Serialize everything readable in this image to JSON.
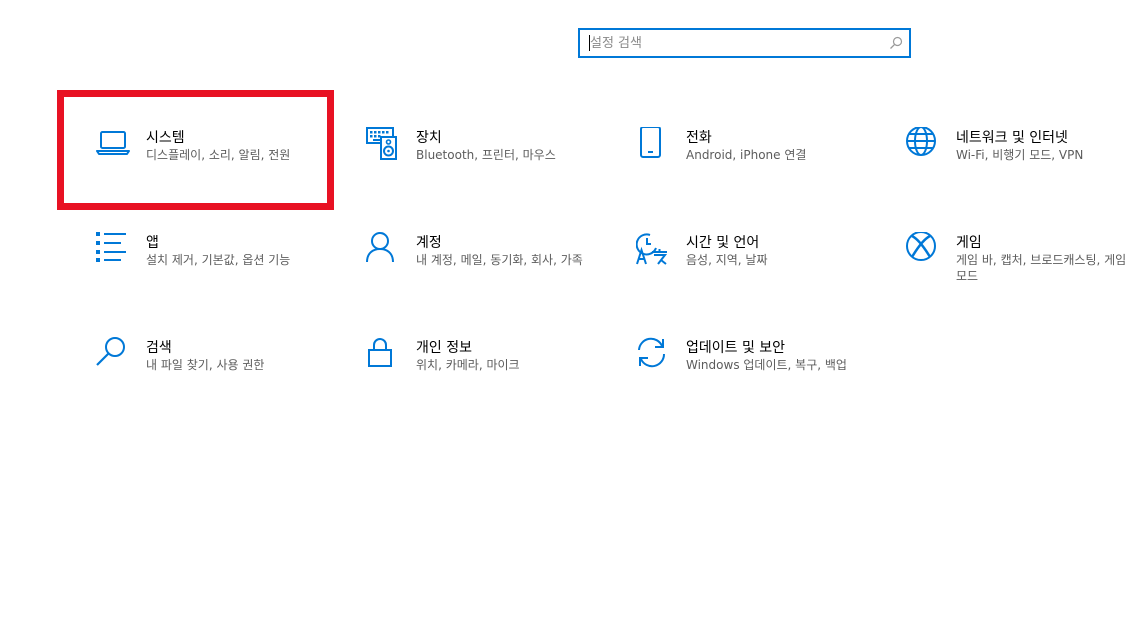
{
  "search": {
    "placeholder": "설정 검색"
  },
  "colors": {
    "accent": "#0078d7",
    "highlight": "#e81123"
  },
  "tiles": [
    {
      "title": "시스템",
      "desc": "디스플레이, 소리, 알림, 전원",
      "icon": "laptop-icon"
    },
    {
      "title": "장치",
      "desc": "Bluetooth, 프린터, 마우스",
      "icon": "keyboard-speaker-icon"
    },
    {
      "title": "전화",
      "desc": "Android, iPhone 연결",
      "icon": "phone-icon"
    },
    {
      "title": "네트워크 및 인터넷",
      "desc": "Wi-Fi, 비행기 모드, VPN",
      "icon": "globe-icon"
    },
    {
      "title": "앱",
      "desc": "설치 제거, 기본값, 옵션 기능",
      "icon": "apps-list-icon"
    },
    {
      "title": "계정",
      "desc": "내 계정, 메일, 동기화, 회사, 가족",
      "icon": "person-icon"
    },
    {
      "title": "시간 및 언어",
      "desc": "음성, 지역, 날짜",
      "icon": "time-language-icon"
    },
    {
      "title": "게임",
      "desc": "게임 바, 캡처, 브로드캐스팅, 게임 모드",
      "icon": "xbox-icon"
    },
    {
      "title": "검색",
      "desc": "내 파일 찾기, 사용 권한",
      "icon": "search-magnifier-icon"
    },
    {
      "title": "개인 정보",
      "desc": "위치, 카메라, 마이크",
      "icon": "lock-icon"
    },
    {
      "title": "업데이트 및 보안",
      "desc": "Windows 업데이트, 복구, 백업",
      "icon": "sync-icon"
    }
  ]
}
